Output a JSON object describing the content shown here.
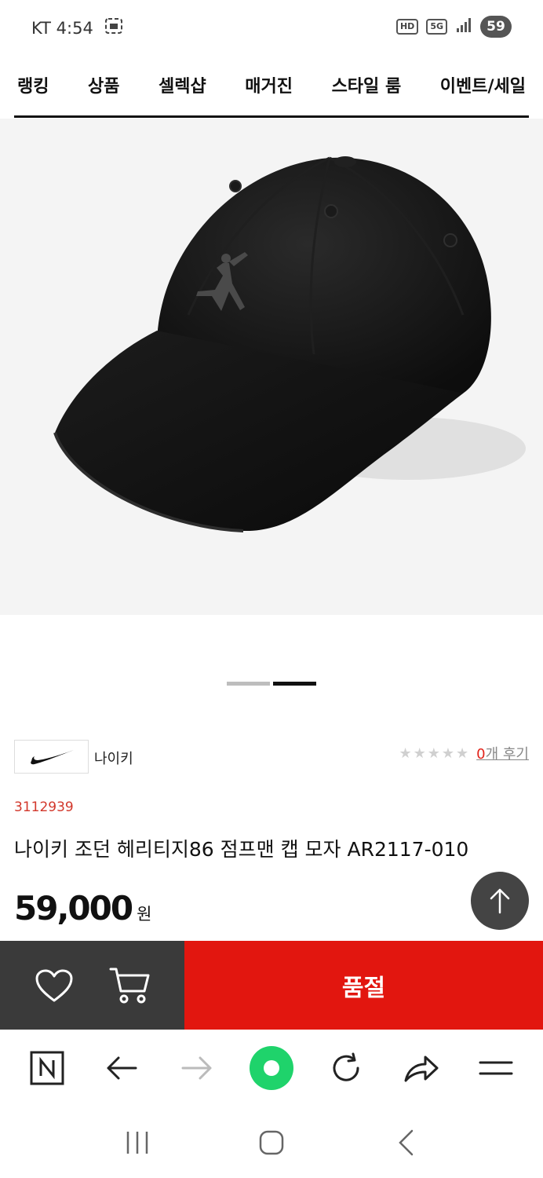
{
  "status_bar": {
    "carrier_time": "KT 4:54",
    "hd_label": "HD",
    "network_label": "5G",
    "battery_level": "59"
  },
  "top_nav": {
    "items": [
      "랭킹",
      "상품",
      "셀렉샵",
      "매거진",
      "스타일 룸",
      "이벤트/세일"
    ]
  },
  "product": {
    "image_icon": "black-baseball-cap-image",
    "brand_name": "나이키",
    "brand_logo_icon": "nike-swoosh-icon",
    "rating_stars": 0,
    "review_count": "0",
    "review_suffix": "개 후기",
    "code": "3112939",
    "title": "나이키 조던 헤리티지86 점프맨 캡 모자 AR2117-010",
    "price": "59,000",
    "currency": "원"
  },
  "carousel": {
    "total_slides": 2,
    "active_index": 1
  },
  "purchase_bar": {
    "soldout_label": "품절"
  },
  "colors": {
    "accent_red": "#e2160f",
    "code_red": "#d2372b",
    "dark_panel": "#3a3a3a",
    "browser_green": "#1fd36b"
  }
}
